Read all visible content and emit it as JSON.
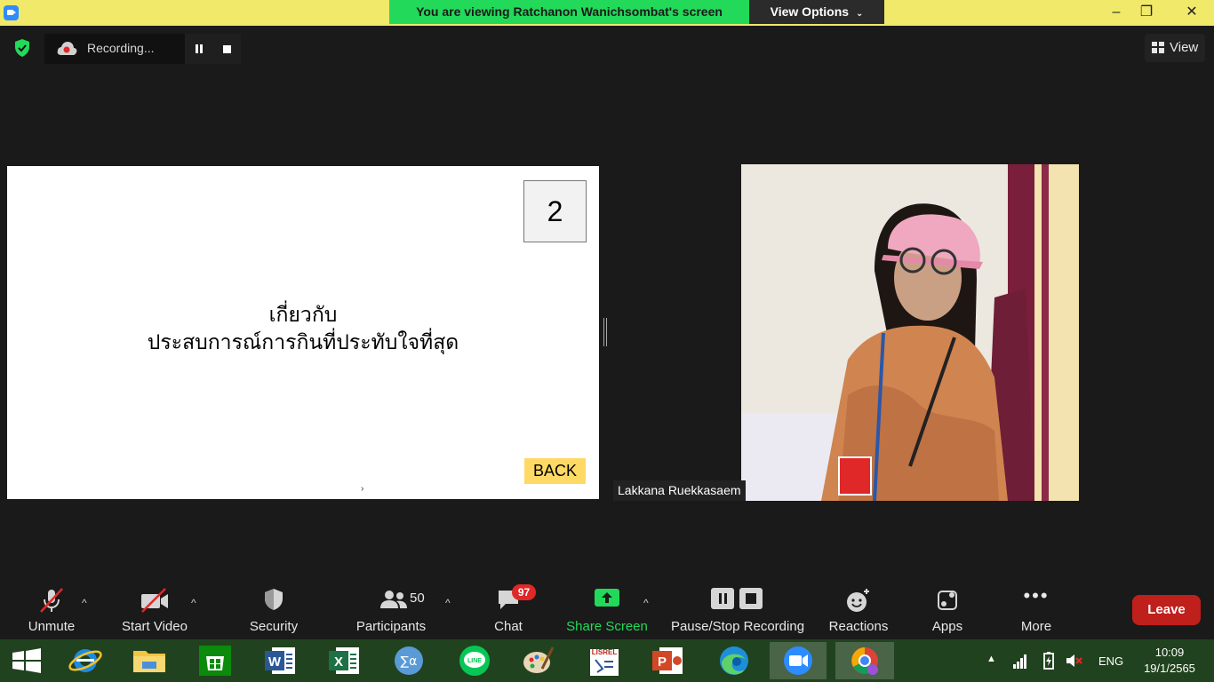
{
  "titlebar": {
    "viewing_text": "You are viewing Ratchanon Wanichsombat's screen",
    "view_options_label": "View Options",
    "minimize": "‒",
    "maximize": "❐",
    "close": "✕"
  },
  "recording": {
    "label": "Recording...",
    "icon": "cloud-record-icon"
  },
  "view_button": {
    "label": "View"
  },
  "slide": {
    "number": "2",
    "title_line1": "เกี่ยวกับ",
    "title_line2": "ประสบการณ์การกินที่ประทับใจที่สุด",
    "back_label": "BACK"
  },
  "participant": {
    "name": "Lakkana Ruekkasaem"
  },
  "toolbar": {
    "unmute": "Unmute",
    "start_video": "Start Video",
    "security": "Security",
    "participants": "Participants",
    "participants_count": "50",
    "chat": "Chat",
    "chat_badge": "97",
    "share_screen": "Share Screen",
    "recording": "Pause/Stop Recording",
    "reactions": "Reactions",
    "apps": "Apps",
    "more": "More",
    "leave": "Leave"
  },
  "taskbar": {
    "language": "ENG",
    "time": "10:09",
    "date": "19/1/2565"
  },
  "colors": {
    "share_green": "#23d959",
    "leave_red": "#c0201c",
    "badge_red": "#e02828",
    "banner_yellow": "#f0e96a",
    "back_yellow": "#ffd966"
  }
}
